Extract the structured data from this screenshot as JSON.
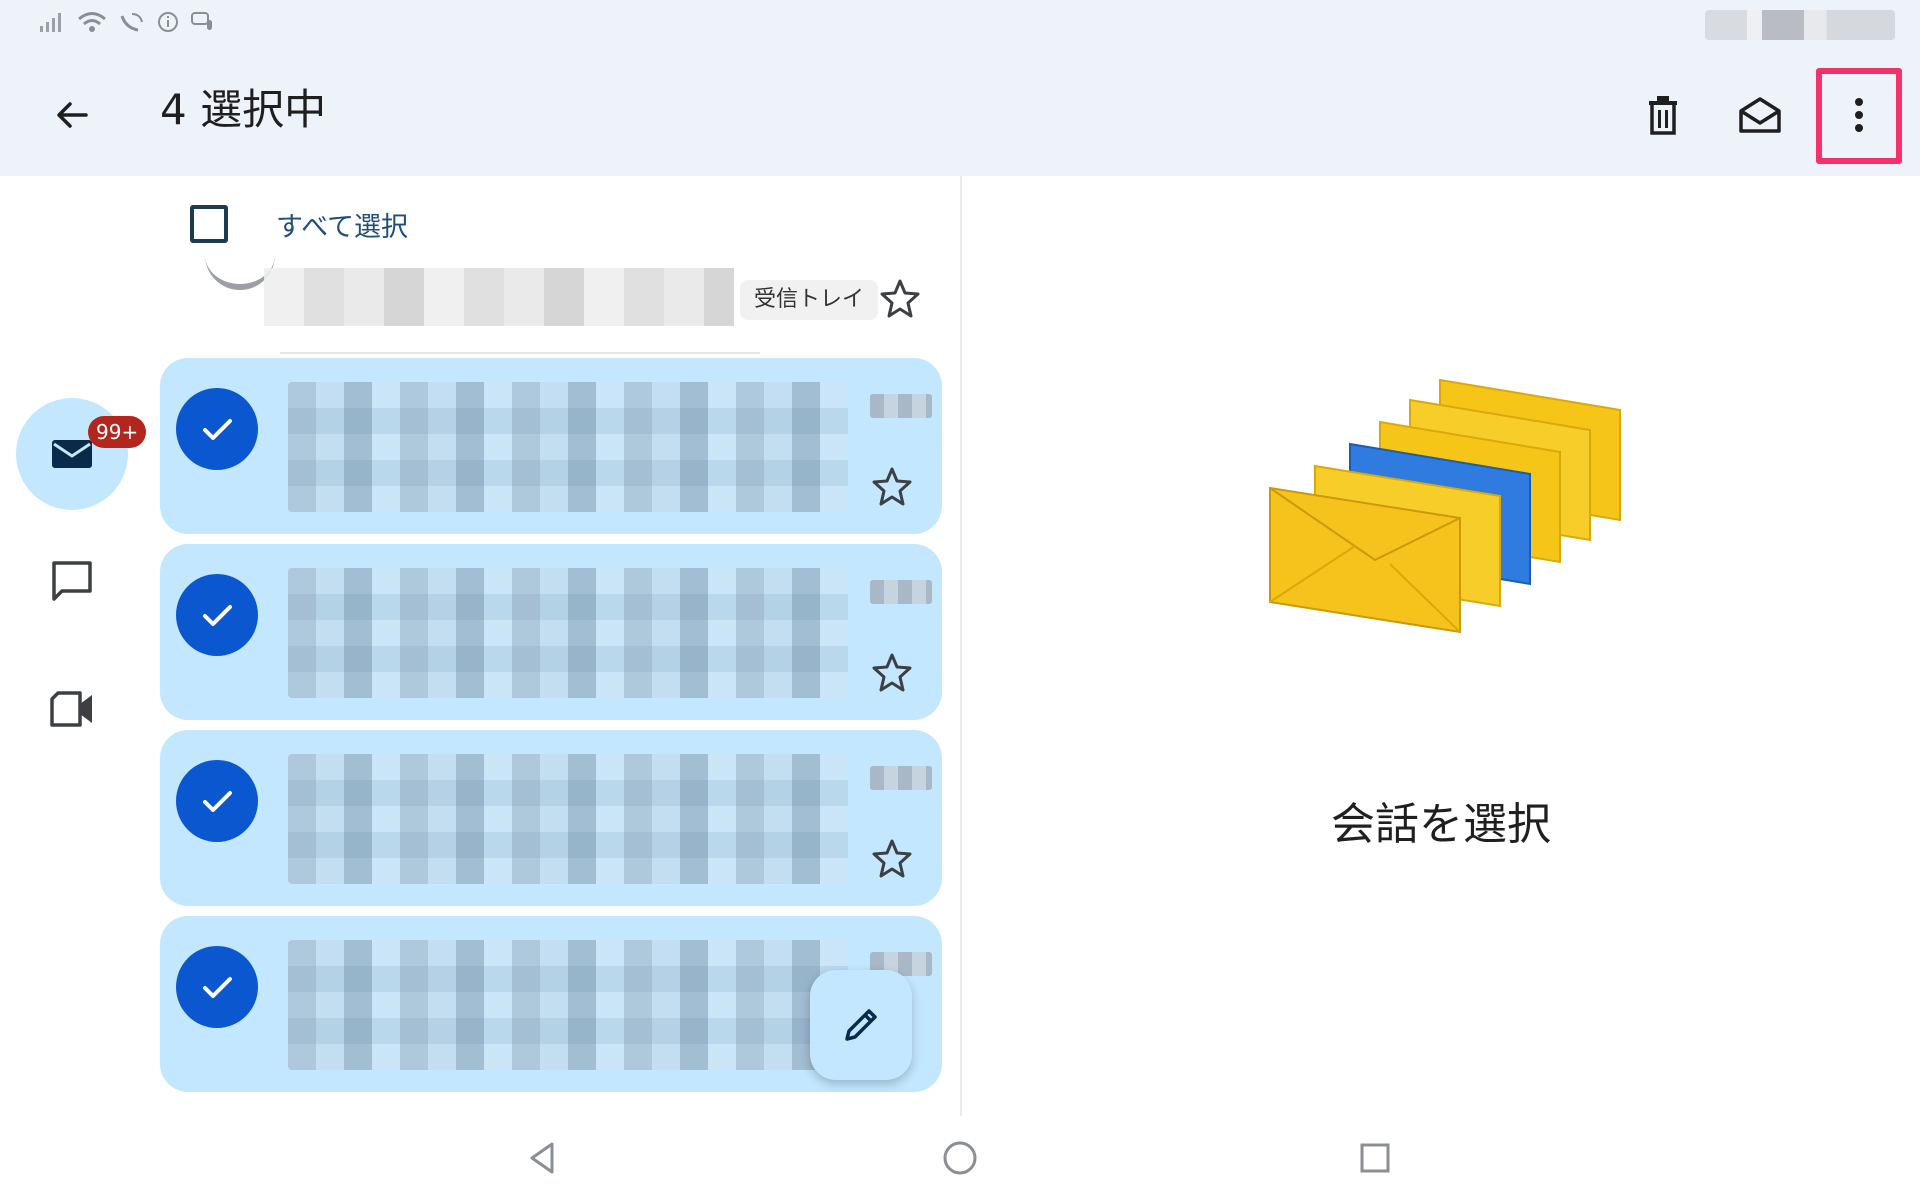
{
  "app_bar": {
    "title": "4 選択中",
    "back_icon": "arrow-back-icon",
    "actions": [
      "delete-icon",
      "mark-read-icon",
      "more-vert-icon"
    ],
    "highlight_color": "#f2336b"
  },
  "nav_rail": {
    "mail_badge": "99+",
    "items": [
      "mail-icon",
      "chat-icon",
      "meet-icon"
    ]
  },
  "list": {
    "select_all_label": "すべて選択",
    "partial_row_chip": "受信トレイ",
    "selected_count": 4
  },
  "detail": {
    "empty_label": "会話を選択"
  },
  "colors": {
    "selected_row": "#c3e7ff",
    "check_avatar": "#0b57d0",
    "badge": "#b3261e",
    "app_bar_bg": "#eef2f9"
  }
}
